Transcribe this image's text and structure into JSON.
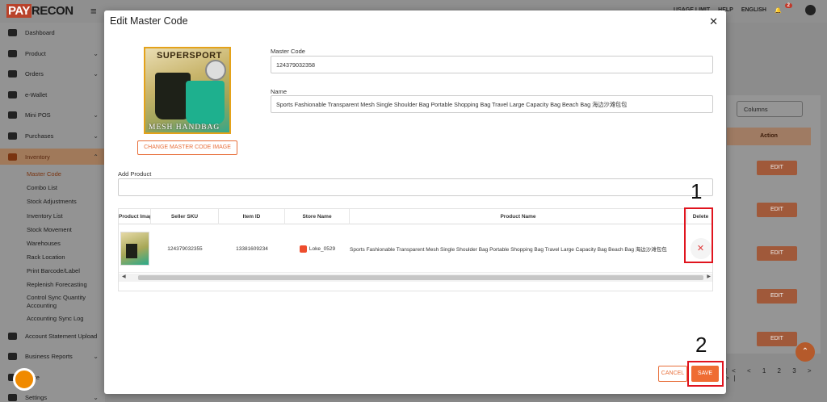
{
  "app": {
    "logo_pay": "PAY",
    "logo_recon": "RECON",
    "top_user": "USAGE LIMIT",
    "top_help": "HELP",
    "top_lang": "ENGLISH",
    "notif_count": "2"
  },
  "sidebar": {
    "items": [
      {
        "label": "Dashboard"
      },
      {
        "label": "Product"
      },
      {
        "label": "Orders"
      },
      {
        "label": "e-Wallet"
      },
      {
        "label": "Mini POS"
      },
      {
        "label": "Purchases"
      },
      {
        "label": "Inventory"
      },
      {
        "label": "Account Statement Upload"
      },
      {
        "label": "Business Reports"
      },
      {
        "label": "Store"
      },
      {
        "label": "Settings"
      }
    ],
    "sub_items": [
      {
        "label": "Master Code"
      },
      {
        "label": "Combo List"
      },
      {
        "label": "Stock Adjustments"
      },
      {
        "label": "Inventory List"
      },
      {
        "label": "Stock Movement"
      },
      {
        "label": "Warehouses"
      },
      {
        "label": "Rack Location"
      },
      {
        "label": "Print Barcode/Label"
      },
      {
        "label": "Replenish Forecasting"
      },
      {
        "label": "Control Sync Quantity"
      },
      {
        "label": "Accounting"
      },
      {
        "label": "Accounting Sync Log"
      }
    ]
  },
  "background": {
    "columns_select": "Columns",
    "action_header": "Action",
    "edit_label": "EDIT",
    "pager": "|< < 1 2 3 > >|"
  },
  "modal": {
    "title": "Edit Master Code",
    "product_image_text_top": "SUPERSPORT",
    "product_image_text_bottom": "MESH HANDBAG",
    "change_image_button": "CHANGE MASTER CODE IMAGE",
    "master_code_label": "Master Code",
    "master_code_value": "124379032358",
    "name_label": "Name",
    "name_value": "Sports Fashionable Transparent Mesh Single Shoulder Bag Portable Shopping Bag Travel Large Capacity Bag Beach Bag 海边沙滩包包",
    "add_product_label": "Add Product",
    "add_product_value": "",
    "table": {
      "headers": [
        "Product Image",
        "Seller SKU",
        "Item ID",
        "Store Name",
        "Product Name",
        "Delete"
      ],
      "rows": [
        {
          "seller_sku": "124379032355",
          "item_id": "13381609234",
          "store_name": "Loke_0529",
          "product_name": "Sports Fashionable Transparent Mesh Single Shoulder Bag Portable Shopping Bag Travel Large Capacity Bag Beach Bag 海边沙滩包包"
        }
      ]
    },
    "cancel_button": "CANCEL",
    "save_button": "SAVE"
  },
  "annotations": {
    "step1": "1",
    "step2": "2"
  },
  "colors": {
    "accent": "#ef6c32",
    "annotation_red": "#e0141e",
    "delete_red": "#e03b3b"
  },
  "icons": [
    "hamburger-icon",
    "bell-icon",
    "user-icon",
    "close-icon",
    "delete-x-icon",
    "store-icon",
    "messenger-icon",
    "scroll-up-icon"
  ]
}
